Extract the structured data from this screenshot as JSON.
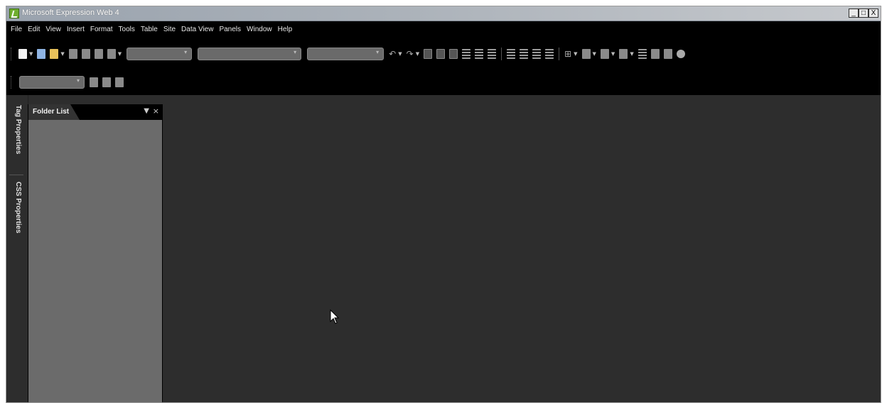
{
  "window": {
    "title": "Microsoft Expression Web 4",
    "controls": [
      "_",
      "□",
      "X"
    ]
  },
  "menu": [
    "File",
    "Edit",
    "View",
    "Insert",
    "Format",
    "Tools",
    "Table",
    "Site",
    "Data View",
    "Panels",
    "Window",
    "Help"
  ],
  "side_tabs": {
    "tag_properties": "Tag Properties",
    "css_properties": "CSS Properties"
  },
  "panel": {
    "title": "Folder List"
  },
  "colors": {
    "menubar": "#000000",
    "workspace": "#2d2d2d",
    "panel_body": "#6b6b6b"
  }
}
